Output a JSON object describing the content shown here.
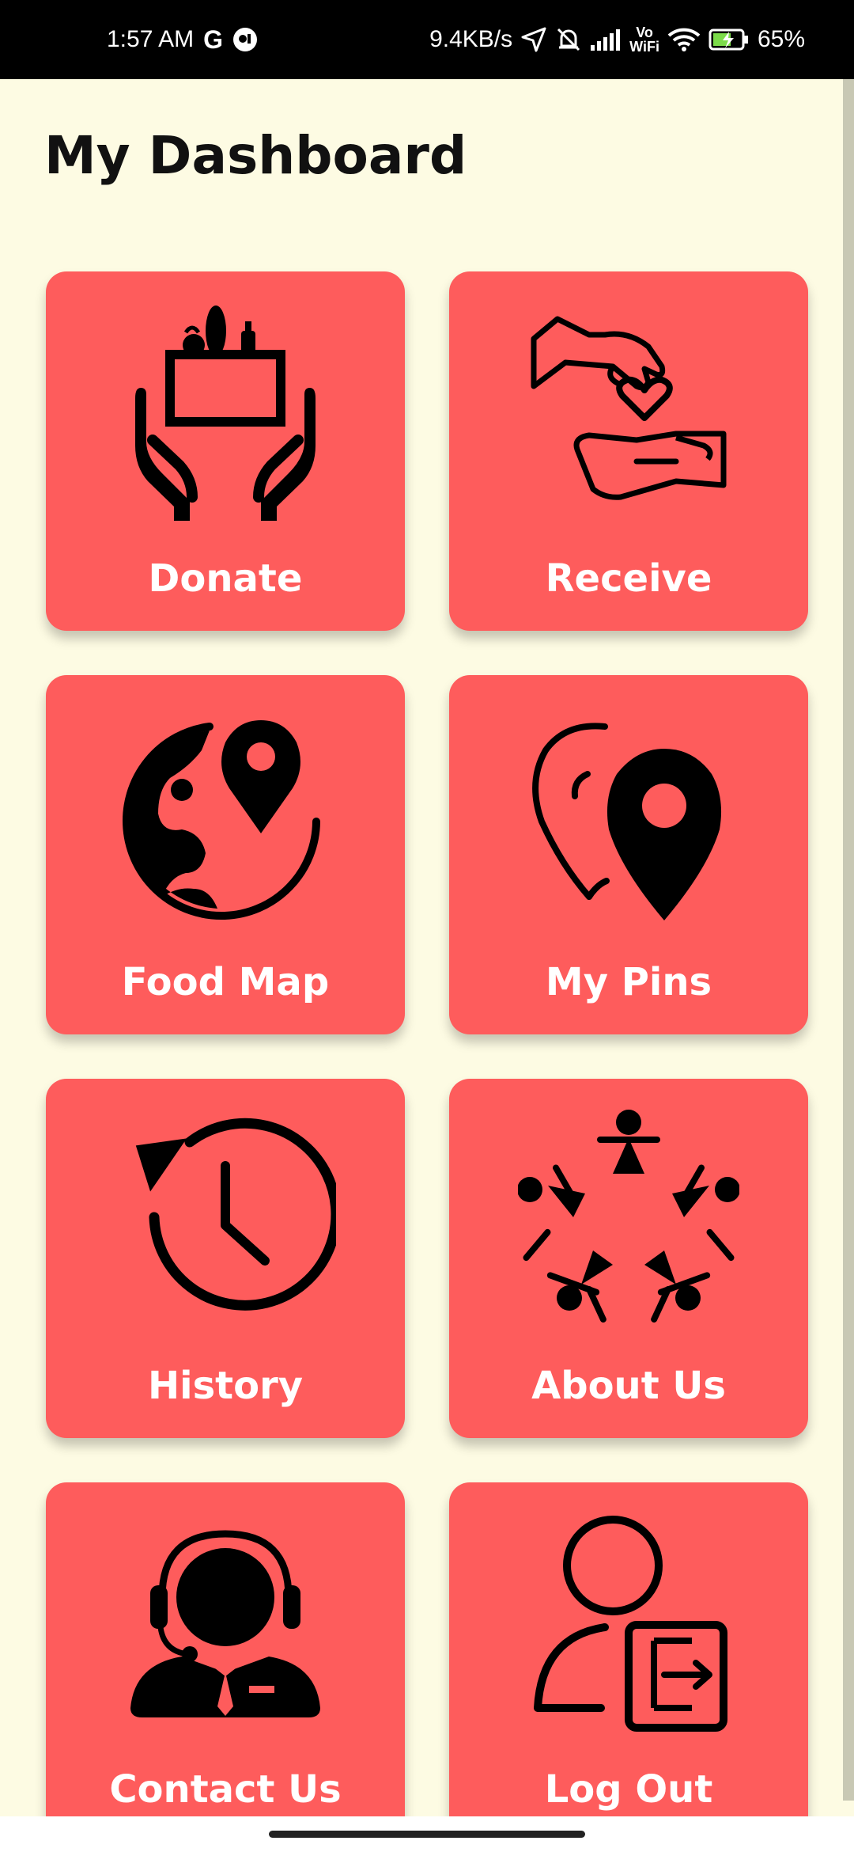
{
  "status_bar": {
    "time": "1:57 AM",
    "google_icon": "G",
    "speed": "9.4KB/s",
    "vowifi_top": "Vo",
    "vowifi_bottom": "WiFi",
    "battery": "65%",
    "icons": [
      "google-icon",
      "app-notification-icon",
      "location-arrow-icon",
      "mute-bell-icon",
      "signal-icon",
      "vowifi-icon",
      "wifi-icon",
      "battery-charging-icon"
    ]
  },
  "header": {
    "title": "My Dashboard"
  },
  "tiles": [
    {
      "label": "Donate",
      "icon": "donate-hands-box-icon"
    },
    {
      "label": "Receive",
      "icon": "receive-hand-heart-icon"
    },
    {
      "label": "Food Map",
      "icon": "globe-pin-icon"
    },
    {
      "label": "My Pins",
      "icon": "map-pins-icon"
    },
    {
      "label": "History",
      "icon": "history-clock-icon"
    },
    {
      "label": "About Us",
      "icon": "people-circle-icon"
    },
    {
      "label": "Contact Us",
      "icon": "support-agent-icon"
    },
    {
      "label": "Log Out",
      "icon": "user-logout-icon"
    }
  ],
  "colors": {
    "background": "#fdfbe3",
    "tile": "#fe5c5c",
    "tile_text": "#ffffff",
    "status_bar": "#000000"
  }
}
